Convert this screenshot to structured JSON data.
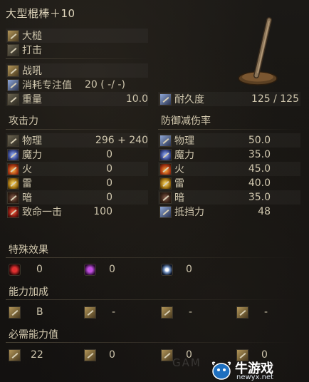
{
  "title": "大型棍棒＋10",
  "weapon_type": "大槌",
  "attack_type": "打击",
  "skill": "战吼",
  "fp_cost": {
    "label": "消耗专注值",
    "value": "20 (   -/   -)"
  },
  "weight": {
    "label": "重量",
    "value": "10.0"
  },
  "durability": {
    "label": "耐久度",
    "value": "125 /   125"
  },
  "attack": {
    "header": "攻击力",
    "rows": [
      {
        "label": "物理",
        "value": "296 +   240"
      },
      {
        "label": "魔力",
        "value": "0"
      },
      {
        "label": "火",
        "value": "0"
      },
      {
        "label": "雷",
        "value": "0"
      },
      {
        "label": "暗",
        "value": "0"
      },
      {
        "label": "致命一击",
        "value": "100"
      }
    ]
  },
  "defense": {
    "header": "防御减伤率",
    "rows": [
      {
        "label": "物理",
        "value": "50.0"
      },
      {
        "label": "魔力",
        "value": "35.0"
      },
      {
        "label": "火",
        "value": "45.0"
      },
      {
        "label": "雷",
        "value": "40.0"
      },
      {
        "label": "暗",
        "value": "35.0"
      },
      {
        "label": "抵挡力",
        "value": "48"
      }
    ]
  },
  "special": {
    "header": "特殊效果",
    "values": [
      "0",
      "0",
      "0"
    ]
  },
  "scaling": {
    "header": "能力加成",
    "values": [
      "B",
      "-",
      "-",
      "-"
    ]
  },
  "requirements": {
    "header": "必需能力值",
    "values": [
      "22",
      "0",
      "0",
      "0"
    ]
  },
  "watermark": {
    "main": "牛游戏",
    "sub": "newyx.net",
    "bg": "GAM"
  },
  "colors": {
    "text": "#cfc6ad",
    "bg": "#171512",
    "accent": "#b39659"
  }
}
